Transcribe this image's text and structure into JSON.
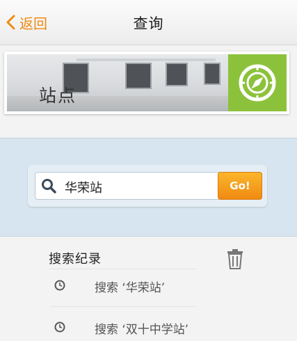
{
  "nav": {
    "back_label": "返回",
    "title": "查询"
  },
  "banner": {
    "label": "站点",
    "icon": "compass-icon",
    "icon_bg": "#8cc23b"
  },
  "search": {
    "value": "华荣站",
    "go_label": "Go!"
  },
  "history": {
    "title": "搜索纪录",
    "items": [
      {
        "label": "搜索 ‘华荣站’"
      },
      {
        "label": "搜索 ‘双十中学站’"
      }
    ]
  },
  "colors": {
    "accent": "#f08a13",
    "search_bg": "#d7e5f0",
    "page_bg": "#f3f3f3"
  }
}
